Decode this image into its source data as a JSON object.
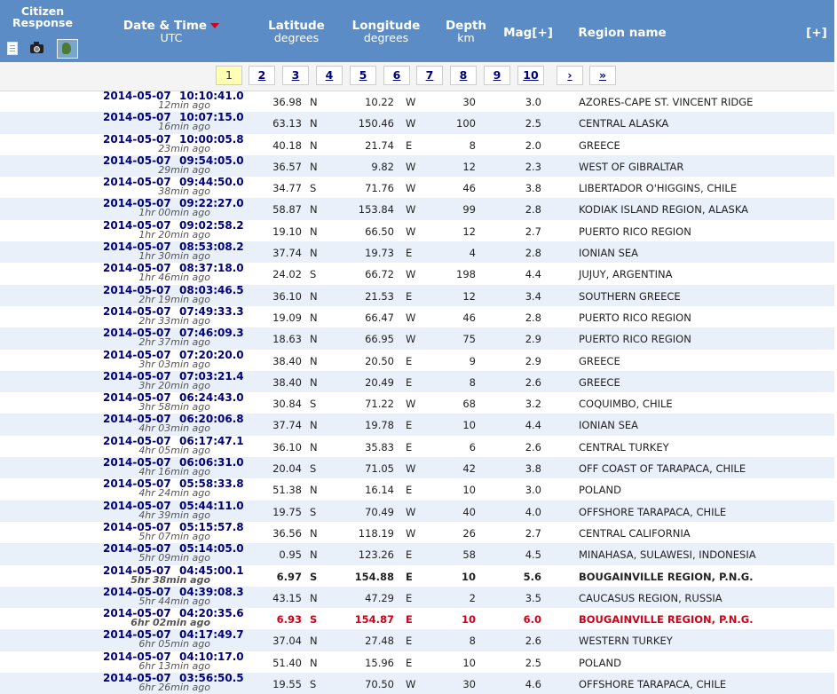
{
  "header": {
    "citizen_response": "Citizen Response",
    "datetime": "Date & Time",
    "datetime_unit": "UTC",
    "latitude": "Latitude",
    "latitude_unit": "degrees",
    "longitude": "Longitude",
    "longitude_unit": "degrees",
    "depth": "Depth",
    "depth_unit": "km",
    "mag": "Mag[+]",
    "region": "Region name",
    "expand": "[+]",
    "icons": [
      "document-icon",
      "camera-icon",
      "map-icon"
    ],
    "sort_arrow_color": "#d0021b"
  },
  "colors": {
    "header_bg": "#5b8cc6",
    "alt_row_bg": "#e9f0fa",
    "link": "#00007a",
    "major": "#d0021b",
    "active_page_bg": "#ffffb3"
  },
  "pagination": {
    "pages": [
      "1",
      "2",
      "3",
      "4",
      "5",
      "6",
      "7",
      "8",
      "9",
      "10",
      "›",
      "»"
    ],
    "active": "1"
  },
  "rows": [
    {
      "date": "2014-05-07",
      "time": "10:10:41.0",
      "ago": "12min ago",
      "lat": "36.98",
      "ns": "N",
      "lon": "10.22",
      "ew": "W",
      "depth": "30",
      "mag": "3.0",
      "region": "AZORES-CAPE ST. VINCENT RIDGE"
    },
    {
      "date": "2014-05-07",
      "time": "10:07:15.0",
      "ago": "16min ago",
      "lat": "63.13",
      "ns": "N",
      "lon": "150.46",
      "ew": "W",
      "depth": "100",
      "mag": "2.5",
      "region": "CENTRAL ALASKA"
    },
    {
      "date": "2014-05-07",
      "time": "10:00:05.8",
      "ago": "23min ago",
      "lat": "40.18",
      "ns": "N",
      "lon": "21.74",
      "ew": "E",
      "depth": "8",
      "mag": "2.0",
      "region": "GREECE"
    },
    {
      "date": "2014-05-07",
      "time": "09:54:05.0",
      "ago": "29min ago",
      "lat": "36.57",
      "ns": "N",
      "lon": "9.82",
      "ew": "W",
      "depth": "12",
      "mag": "2.3",
      "region": "WEST OF GIBRALTAR"
    },
    {
      "date": "2014-05-07",
      "time": "09:44:50.0",
      "ago": "38min ago",
      "lat": "34.77",
      "ns": "S",
      "lon": "71.76",
      "ew": "W",
      "depth": "46",
      "mag": "3.8",
      "region": "LIBERTADOR O'HIGGINS, CHILE"
    },
    {
      "date": "2014-05-07",
      "time": "09:22:27.0",
      "ago": "1hr 00min ago",
      "lat": "58.87",
      "ns": "N",
      "lon": "153.84",
      "ew": "W",
      "depth": "99",
      "mag": "2.8",
      "region": "KODIAK ISLAND REGION, ALASKA"
    },
    {
      "date": "2014-05-07",
      "time": "09:02:58.2",
      "ago": "1hr 20min ago",
      "lat": "19.10",
      "ns": "N",
      "lon": "66.50",
      "ew": "W",
      "depth": "12",
      "mag": "2.7",
      "region": "PUERTO RICO REGION"
    },
    {
      "date": "2014-05-07",
      "time": "08:53:08.2",
      "ago": "1hr 30min ago",
      "lat": "37.74",
      "ns": "N",
      "lon": "19.73",
      "ew": "E",
      "depth": "4",
      "mag": "2.8",
      "region": "IONIAN SEA"
    },
    {
      "date": "2014-05-07",
      "time": "08:37:18.0",
      "ago": "1hr 46min ago",
      "lat": "24.02",
      "ns": "S",
      "lon": "66.72",
      "ew": "W",
      "depth": "198",
      "mag": "4.4",
      "region": "JUJUY, ARGENTINA"
    },
    {
      "date": "2014-05-07",
      "time": "08:03:46.5",
      "ago": "2hr 19min ago",
      "lat": "36.10",
      "ns": "N",
      "lon": "21.53",
      "ew": "E",
      "depth": "12",
      "mag": "3.4",
      "region": "SOUTHERN GREECE"
    },
    {
      "date": "2014-05-07",
      "time": "07:49:33.3",
      "ago": "2hr 33min ago",
      "lat": "19.09",
      "ns": "N",
      "lon": "66.47",
      "ew": "W",
      "depth": "46",
      "mag": "2.8",
      "region": "PUERTO RICO REGION"
    },
    {
      "date": "2014-05-07",
      "time": "07:46:09.3",
      "ago": "2hr 37min ago",
      "lat": "18.63",
      "ns": "N",
      "lon": "66.95",
      "ew": "W",
      "depth": "75",
      "mag": "2.9",
      "region": "PUERTO RICO REGION"
    },
    {
      "date": "2014-05-07",
      "time": "07:20:20.0",
      "ago": "3hr 03min ago",
      "lat": "38.40",
      "ns": "N",
      "lon": "20.50",
      "ew": "E",
      "depth": "9",
      "mag": "2.9",
      "region": "GREECE"
    },
    {
      "date": "2014-05-07",
      "time": "07:03:21.4",
      "ago": "3hr 20min ago",
      "lat": "38.40",
      "ns": "N",
      "lon": "20.49",
      "ew": "E",
      "depth": "8",
      "mag": "2.6",
      "region": "GREECE"
    },
    {
      "date": "2014-05-07",
      "time": "06:24:43.0",
      "ago": "3hr 58min ago",
      "lat": "30.84",
      "ns": "S",
      "lon": "71.22",
      "ew": "W",
      "depth": "68",
      "mag": "3.2",
      "region": "COQUIMBO, CHILE"
    },
    {
      "date": "2014-05-07",
      "time": "06:20:06.8",
      "ago": "4hr 03min ago",
      "lat": "37.74",
      "ns": "N",
      "lon": "19.78",
      "ew": "E",
      "depth": "10",
      "mag": "4.4",
      "region": "IONIAN SEA"
    },
    {
      "date": "2014-05-07",
      "time": "06:17:47.1",
      "ago": "4hr 05min ago",
      "lat": "36.10",
      "ns": "N",
      "lon": "35.83",
      "ew": "E",
      "depth": "6",
      "mag": "2.6",
      "region": "CENTRAL TURKEY"
    },
    {
      "date": "2014-05-07",
      "time": "06:06:31.0",
      "ago": "4hr 16min ago",
      "lat": "20.04",
      "ns": "S",
      "lon": "71.05",
      "ew": "W",
      "depth": "42",
      "mag": "3.8",
      "region": "OFF COAST OF TARAPACA, CHILE"
    },
    {
      "date": "2014-05-07",
      "time": "05:58:33.8",
      "ago": "4hr 24min ago",
      "lat": "51.38",
      "ns": "N",
      "lon": "16.14",
      "ew": "E",
      "depth": "10",
      "mag": "3.0",
      "region": "POLAND"
    },
    {
      "date": "2014-05-07",
      "time": "05:44:11.0",
      "ago": "4hr 39min ago",
      "lat": "19.75",
      "ns": "S",
      "lon": "70.49",
      "ew": "W",
      "depth": "40",
      "mag": "4.0",
      "region": "OFFSHORE TARAPACA, CHILE"
    },
    {
      "date": "2014-05-07",
      "time": "05:15:57.8",
      "ago": "5hr 07min ago",
      "lat": "36.56",
      "ns": "N",
      "lon": "118.19",
      "ew": "W",
      "depth": "26",
      "mag": "2.7",
      "region": "CENTRAL CALIFORNIA"
    },
    {
      "date": "2014-05-07",
      "time": "05:14:05.0",
      "ago": "5hr 09min ago",
      "lat": "0.95",
      "ns": "N",
      "lon": "123.26",
      "ew": "E",
      "depth": "58",
      "mag": "4.5",
      "region": "MINAHASA, SULAWESI, INDONESIA"
    },
    {
      "date": "2014-05-07",
      "time": "04:45:00.1",
      "ago": "5hr 38min ago",
      "lat": "6.97",
      "ns": "S",
      "lon": "154.88",
      "ew": "E",
      "depth": "10",
      "mag": "5.6",
      "region": "BOUGAINVILLE REGION, P.N.G.",
      "style": "strong"
    },
    {
      "date": "2014-05-07",
      "time": "04:39:08.3",
      "ago": "5hr 44min ago",
      "lat": "43.15",
      "ns": "N",
      "lon": "47.29",
      "ew": "E",
      "depth": "2",
      "mag": "3.5",
      "region": "CAUCASUS REGION, RUSSIA"
    },
    {
      "date": "2014-05-07",
      "time": "04:20:35.6",
      "ago": "6hr 02min ago",
      "lat": "6.93",
      "ns": "S",
      "lon": "154.87",
      "ew": "E",
      "depth": "10",
      "mag": "6.0",
      "region": "BOUGAINVILLE REGION, P.N.G.",
      "style": "major"
    },
    {
      "date": "2014-05-07",
      "time": "04:17:49.7",
      "ago": "6hr 05min ago",
      "lat": "37.04",
      "ns": "N",
      "lon": "27.48",
      "ew": "E",
      "depth": "8",
      "mag": "2.6",
      "region": "WESTERN TURKEY"
    },
    {
      "date": "2014-05-07",
      "time": "04:10:17.0",
      "ago": "6hr 13min ago",
      "lat": "51.40",
      "ns": "N",
      "lon": "15.96",
      "ew": "E",
      "depth": "10",
      "mag": "2.5",
      "region": "POLAND"
    },
    {
      "date": "2014-05-07",
      "time": "03:56:50.5",
      "ago": "6hr 26min ago",
      "lat": "19.55",
      "ns": "S",
      "lon": "70.50",
      "ew": "W",
      "depth": "30",
      "mag": "4.6",
      "region": "OFFSHORE TARAPACA, CHILE"
    }
  ]
}
